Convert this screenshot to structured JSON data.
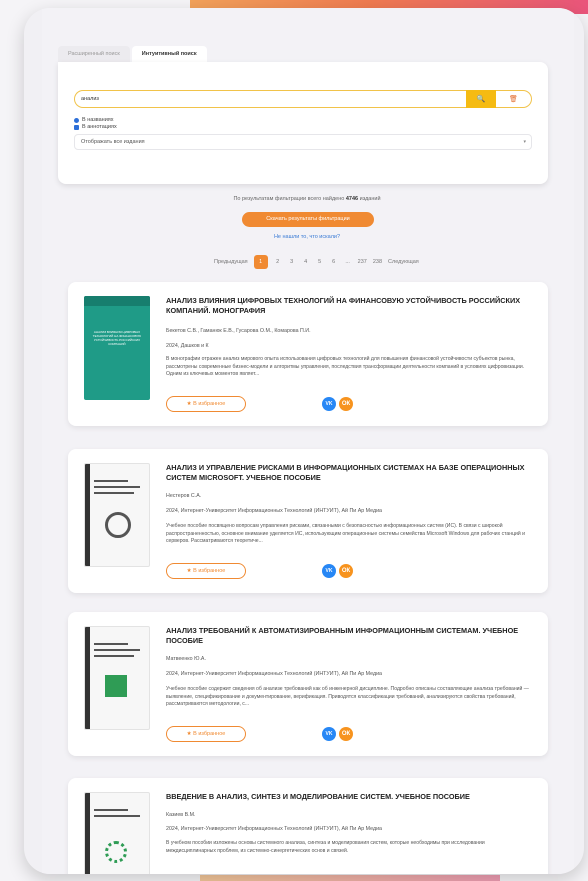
{
  "tabs": [
    "Расширенный поиск",
    "Интуитивный поиск"
  ],
  "search": {
    "value": "анализ",
    "search_icon": "🔍",
    "clear_icon": "🗑",
    "checks": [
      "В названиях",
      "В аннотациях"
    ],
    "select_value": "Отображать все издания"
  },
  "results": {
    "prefix": "По результатам фильтрации всего найдено",
    "count": "4746",
    "suffix": "изданий",
    "download_label": "Скачать результаты фильтрации",
    "not_found_label": "Не нашли то, что искали?"
  },
  "pager": {
    "prev": "Предыдущая",
    "pages": [
      "1",
      "2",
      "3",
      "4",
      "5",
      "6",
      "...",
      "237",
      "238"
    ],
    "next": "Следующая",
    "active": "1"
  },
  "books": [
    {
      "title": "АНАЛИЗ ВЛИЯНИЯ ЦИФРОВЫХ ТЕХНОЛОГИЙ НА ФИНАНСОВУЮ УСТОЙЧИВОСТЬ РОССИЙСКИХ КОМПАНИЙ. МОНОГРАФИЯ",
      "authors": "Бекетов С.В., Гаманюк Е.В., Гусарова О.М., Комарова П.И.",
      "publisher": "2024, Дашков и К",
      "description": "В монографии отражен анализ мирового опыта использования цифровых технологий для повышения финансовой устойчивости субъектов рынка, рассмотрены современные бизнес-модели и алгоритмы управления, последствия трансформации деятельности компаний в условиях цифровизации. Одним из ключевых моментов являет...",
      "fav_label": "★ В избранное",
      "cover_text": "АНАЛИЗ ВЛИЯНИЯ ЦИФРОВЫХ ТЕХНОЛОГИЙ НА ФИНАНСОВУЮ УСТОЙЧИВОСТЬ РОССИЙСКИХ КОМПАНИЙ"
    },
    {
      "title": "АНАЛИЗ И УПРАВЛЕНИЕ РИСКАМИ В ИНФОРМАЦИОННЫХ СИСТЕМАХ НА БАЗЕ ОПЕРАЦИОННЫХ СИСТЕМ MICROSOFT. УЧЕБНОЕ ПОСОБИЕ",
      "authors": "Нестеров С.А.",
      "publisher": "2024, Интернет-Университет Информационных Технологий (ИНТУИТ), Ай Пи Ар Медиа",
      "description": "Учебное пособие посвящено вопросам управления рисками, связанными с безопасностью информационных систем (ИС). В связи с широкой распространенностью, основное внимание уделяется ИС, использующим операционные системы семейства Microsoft Windows для рабочих станций и серверов. Рассматриваются теоретиче...",
      "fav_label": "★ В избранное"
    },
    {
      "title": "АНАЛИЗ ТРЕБОВАНИЙ К АВТОМАТИЗИРОВАННЫМ ИНФОРМАЦИОННЫМ СИСТЕМАМ. УЧЕБНОЕ ПОСОБИЕ",
      "authors": "Матвеенко Ю.А.",
      "publisher": "2024, Интернет-Университет Информационных Технологий (ИНТУИТ), Ай Пи Ар Медиа",
      "description": "Учебное пособие содержит сведения об анализе требований как об инженерной дисциплине. Подробно описаны составляющие анализа требований — выявление, спецификирование и документирование, верификация. Приводятся классификации требований, анализируются свойства требований, рассматриваются методологии, с...",
      "fav_label": "★ В избранное"
    },
    {
      "title": "ВВЕДЕНИЕ В АНАЛИЗ, СИНТЕЗ И МОДЕЛИРОВАНИЕ СИСТЕМ. УЧЕБНОЕ ПОСОБИЕ",
      "authors": "Казиев В.М.",
      "publisher": "2024, Интернет-Университет Информационных Технологий (ИНТУИТ), Ай Пи Ар Медиа",
      "description": "В учебном пособии изложены основы системного анализа, синтеза и моделирования систем, которые необходимы при исследовании междисциплинарных проблем, из системно-синергетических основ и связей.",
      "fav_label": "★ В избранное"
    }
  ],
  "social": {
    "vk": "VK",
    "ok": "ОК"
  }
}
